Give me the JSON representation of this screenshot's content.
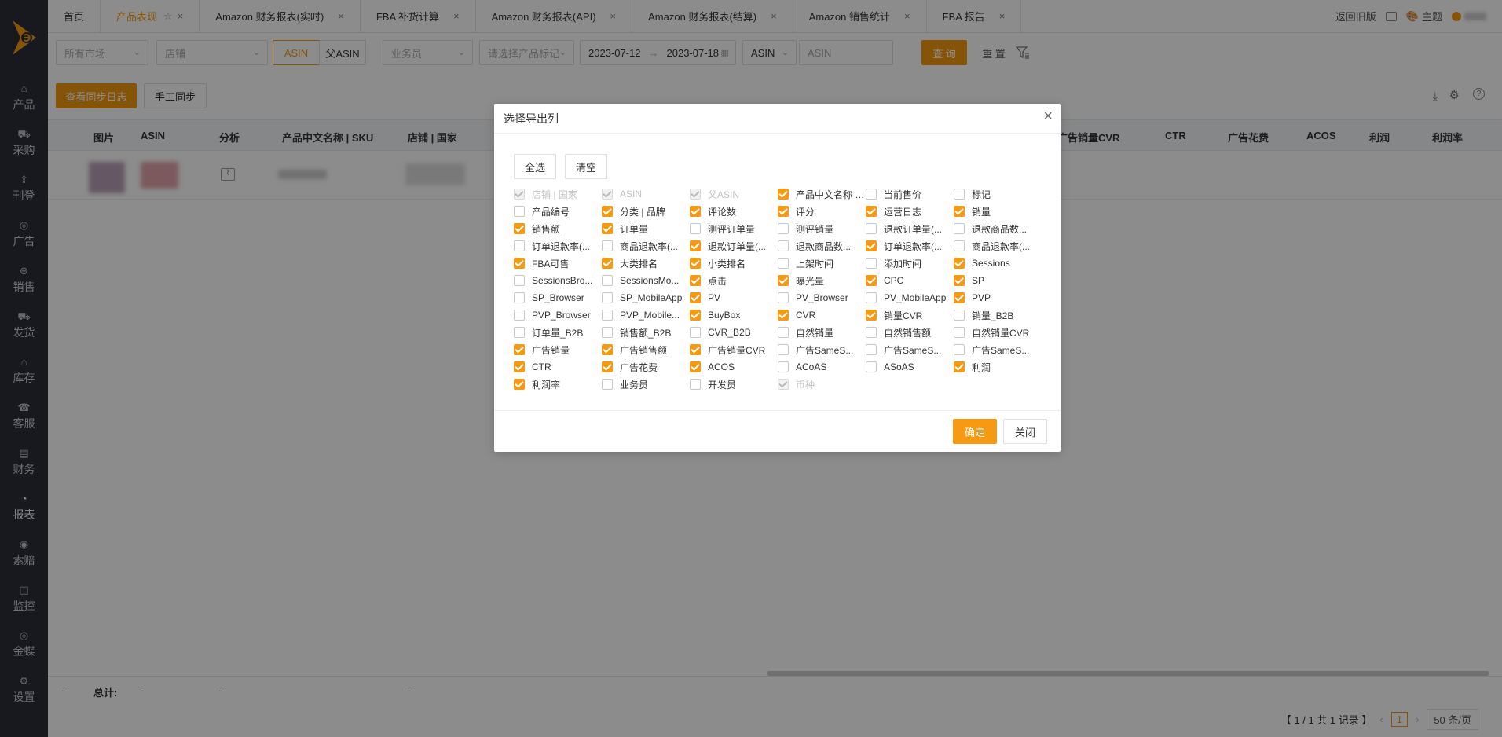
{
  "sidebar": {
    "items": [
      {
        "label": "产品",
        "icon": "bag-icon"
      },
      {
        "label": "采购",
        "icon": "cart-icon"
      },
      {
        "label": "刊登",
        "icon": "upload-icon"
      },
      {
        "label": "广告",
        "icon": "ad-icon"
      },
      {
        "label": "销售",
        "icon": "sales-icon"
      },
      {
        "label": "发货",
        "icon": "truck-icon"
      },
      {
        "label": "库存",
        "icon": "warehouse-icon"
      },
      {
        "label": "客服",
        "icon": "headset-icon"
      },
      {
        "label": "财务",
        "icon": "finance-icon"
      },
      {
        "label": "报表",
        "icon": "chart-pie-icon"
      },
      {
        "label": "索赔",
        "icon": "claim-icon"
      },
      {
        "label": "监控",
        "icon": "monitor-icon"
      },
      {
        "label": "金蝶",
        "icon": "kingdee-icon"
      },
      {
        "label": "设置",
        "icon": "gear-icon"
      }
    ],
    "active_index": 9
  },
  "tabs": [
    {
      "label": "首页",
      "closable": false
    },
    {
      "label": "产品表现",
      "closable": true,
      "active": true
    },
    {
      "label": "Amazon 财务报表(实时)",
      "closable": true
    },
    {
      "label": "FBA 补货计算",
      "closable": true
    },
    {
      "label": "Amazon 财务报表(API)",
      "closable": true
    },
    {
      "label": "Amazon 财务报表(结算)",
      "closable": true
    },
    {
      "label": "Amazon 销售统计",
      "closable": true
    },
    {
      "label": "FBA 报告",
      "closable": true
    }
  ],
  "topright": {
    "back_old": "返回旧版",
    "theme": "主题"
  },
  "filters": {
    "market_placeholder": "所有市场",
    "shop_placeholder": "店铺",
    "asin_toggle": "ASIN",
    "parent_asin_toggle": "父ASIN",
    "salesperson_placeholder": "业务员",
    "tag_placeholder": "请选择产品标记",
    "date_start": "2023-07-12",
    "date_sep": "→",
    "date_end": "2023-07-18",
    "search_type": "ASIN",
    "search_placeholder": "ASIN",
    "query_button": "查 询",
    "reset_button": "重 置"
  },
  "actions": {
    "sync_log": "查看同步日志",
    "manual_sync": "手工同步"
  },
  "table": {
    "headers_left": [
      "图片",
      "ASIN",
      "分析",
      "产品中文名称 | SKU",
      "店铺 | 国家"
    ],
    "headers_right": [
      "广告销量CVR",
      "CTR",
      "广告花费",
      "ACOS",
      "利润",
      "利润率"
    ],
    "total_label": "总计:",
    "dash": "-"
  },
  "pagination": {
    "summary": "【 1 / 1 共 1 记录 】",
    "current_page": "1",
    "page_size": "50 条/页"
  },
  "modal": {
    "title": "选择导出列",
    "select_all": "全选",
    "clear": "清空",
    "confirm": "确定",
    "close": "关闭",
    "columns": [
      {
        "label": "店铺 | 国家",
        "checked": true,
        "disabled": true
      },
      {
        "label": "ASIN",
        "checked": true,
        "disabled": true
      },
      {
        "label": "父ASIN",
        "checked": true,
        "disabled": true
      },
      {
        "label": "产品中文名称 | SKU",
        "checked": true
      },
      {
        "label": "当前售价",
        "checked": false
      },
      {
        "label": "标记",
        "checked": false
      },
      {
        "label": "产品编号",
        "checked": false
      },
      {
        "label": "分类 | 品牌",
        "checked": true
      },
      {
        "label": "评论数",
        "checked": true
      },
      {
        "label": "评分",
        "checked": true
      },
      {
        "label": "运营日志",
        "checked": true
      },
      {
        "label": "销量",
        "checked": true
      },
      {
        "label": "销售额",
        "checked": true
      },
      {
        "label": "订单量",
        "checked": true
      },
      {
        "label": "测评订单量",
        "checked": false
      },
      {
        "label": "测评销量",
        "checked": false
      },
      {
        "label": "退款订单量(...",
        "checked": false
      },
      {
        "label": "退款商品数...",
        "checked": false
      },
      {
        "label": "订单退款率(...",
        "checked": false
      },
      {
        "label": "商品退款率(...",
        "checked": false
      },
      {
        "label": "退款订单量(...",
        "checked": true
      },
      {
        "label": "退款商品数...",
        "checked": false
      },
      {
        "label": "订单退款率(...",
        "checked": true
      },
      {
        "label": "商品退款率(...",
        "checked": false
      },
      {
        "label": "FBA可售",
        "checked": true
      },
      {
        "label": "大类排名",
        "checked": true
      },
      {
        "label": "小类排名",
        "checked": true
      },
      {
        "label": "上架时间",
        "checked": false
      },
      {
        "label": "添加时间",
        "checked": false
      },
      {
        "label": "Sessions",
        "checked": true
      },
      {
        "label": "SessionsBro...",
        "checked": false
      },
      {
        "label": "SessionsMo...",
        "checked": false
      },
      {
        "label": "点击",
        "checked": true
      },
      {
        "label": "曝光量",
        "checked": true
      },
      {
        "label": "CPC",
        "checked": true
      },
      {
        "label": "SP",
        "checked": true
      },
      {
        "label": "SP_Browser",
        "checked": false
      },
      {
        "label": "SP_MobileApp",
        "checked": false
      },
      {
        "label": "PV",
        "checked": true
      },
      {
        "label": "PV_Browser",
        "checked": false
      },
      {
        "label": "PV_MobileApp",
        "checked": false
      },
      {
        "label": "PVP",
        "checked": true
      },
      {
        "label": "PVP_Browser",
        "checked": false
      },
      {
        "label": "PVP_Mobile...",
        "checked": false
      },
      {
        "label": "BuyBox",
        "checked": true
      },
      {
        "label": "CVR",
        "checked": true
      },
      {
        "label": "销量CVR",
        "checked": true
      },
      {
        "label": "销量_B2B",
        "checked": false
      },
      {
        "label": "订单量_B2B",
        "checked": false
      },
      {
        "label": "销售额_B2B",
        "checked": false
      },
      {
        "label": "CVR_B2B",
        "checked": false
      },
      {
        "label": "自然销量",
        "checked": false
      },
      {
        "label": "自然销售额",
        "checked": false
      },
      {
        "label": "自然销量CVR",
        "checked": false
      },
      {
        "label": "广告销量",
        "checked": true
      },
      {
        "label": "广告销售额",
        "checked": true
      },
      {
        "label": "广告销量CVR",
        "checked": true
      },
      {
        "label": "广告SameS...",
        "checked": false
      },
      {
        "label": "广告SameS...",
        "checked": false
      },
      {
        "label": "广告SameS...",
        "checked": false
      },
      {
        "label": "CTR",
        "checked": true
      },
      {
        "label": "广告花费",
        "checked": true
      },
      {
        "label": "ACOS",
        "checked": true
      },
      {
        "label": "ACoAS",
        "checked": false
      },
      {
        "label": "ASoAS",
        "checked": false
      },
      {
        "label": "利润",
        "checked": true
      },
      {
        "label": "利润率",
        "checked": true
      },
      {
        "label": "业务员",
        "checked": false
      },
      {
        "label": "开发员",
        "checked": false
      },
      {
        "label": "币种",
        "checked": true,
        "disabled": true
      }
    ]
  },
  "colors": {
    "accent": "#f59a12",
    "sidebar": "#2a2f3a"
  }
}
